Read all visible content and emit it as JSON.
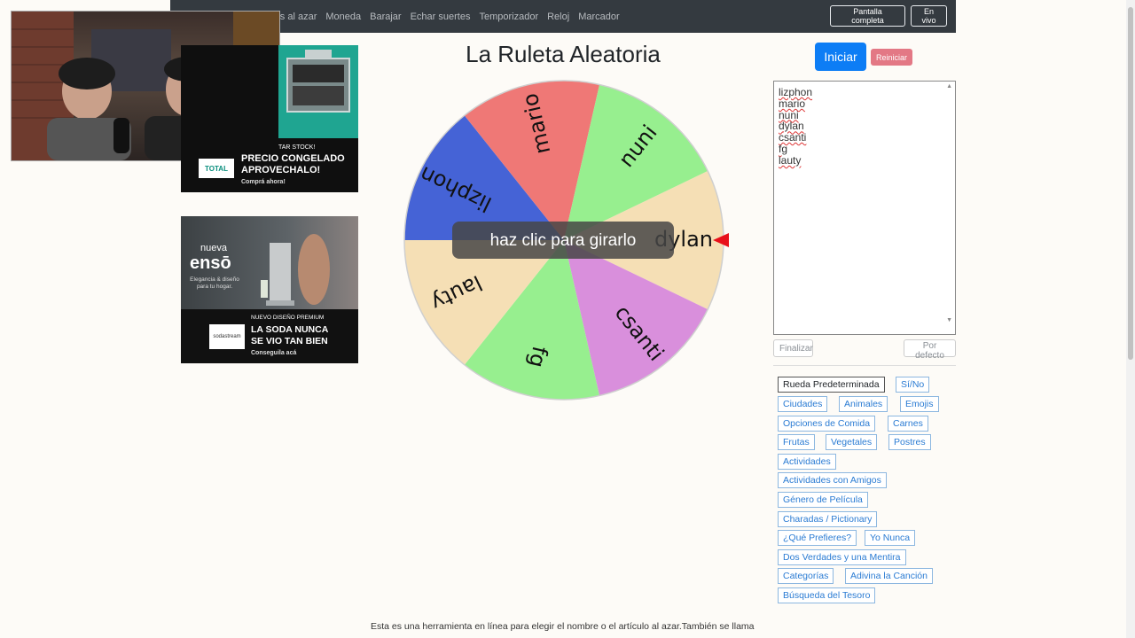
{
  "nav": {
    "links": [
      "ros al azar",
      "Moneda",
      "Barajar",
      "Echar suertes",
      "Temporizador",
      "Reloj",
      "Marcador"
    ],
    "fullscreen_label": "Pantalla completa",
    "live_label": "En vivo"
  },
  "ads": {
    "ad1": {
      "line_small": "TAR STOCK!",
      "headline1": "PRECIO CONGELADO",
      "headline2": "APROVECHALO!",
      "cta": "Comprá ahora!",
      "brand": "TOTAL"
    },
    "ad2": {
      "brand_top": "nueva",
      "brand_name": "ensō",
      "tagline1": "Elegancia & diseño",
      "tagline2": "para tu hogar.",
      "line_small": "NUEVO DISEÑO PREMIUM",
      "headline1": "LA SODA NUNCA",
      "headline2": "SE VIO TAN BIEN",
      "cta": "Conseguila acá",
      "logo": "sodastream"
    }
  },
  "title": "La Ruleta Aleatoria",
  "buttons": {
    "start": "Iniciar",
    "reset": "Reiniciar",
    "finish": "Finalizar",
    "default": "Por defecto"
  },
  "wheel": {
    "overlay": "haz clic para girarlo",
    "segments": [
      {
        "name": "dylan",
        "color": "#f5dfb5"
      },
      {
        "name": "csanti",
        "color": "#d98fdc"
      },
      {
        "name": "fg",
        "color": "#97ef8f"
      },
      {
        "name": "lauty",
        "color": "#f5dfb5"
      },
      {
        "name": "lizphon",
        "color": "#4563d6"
      },
      {
        "name": "mario",
        "color": "#ef7876"
      },
      {
        "name": "nuni",
        "color": "#97ef8f"
      }
    ],
    "pointer_color": "#e8101a"
  },
  "names": [
    "lizphon",
    "mario",
    "nuni",
    "dylan",
    "csanti",
    "fg",
    "lauty"
  ],
  "presets": [
    "Rueda Predeterminada",
    "Sí/No",
    "Ciudades",
    "Animales",
    "Emojis",
    "Opciones de Comida",
    "Carnes",
    "Frutas",
    "Vegetales",
    "Postres",
    "Actividades",
    "Actividades con Amigos",
    "Género de Película",
    "Charadas / Pictionary",
    "¿Qué Prefieres?",
    "Yo Nunca",
    "Dos Verdades y una Mentira",
    "Categorías",
    "Adivina la Canción",
    "Búsqueda del Tesoro"
  ],
  "description": "Esta es una herramienta en línea para elegir el nombre o el artículo al azar.También se llama"
}
